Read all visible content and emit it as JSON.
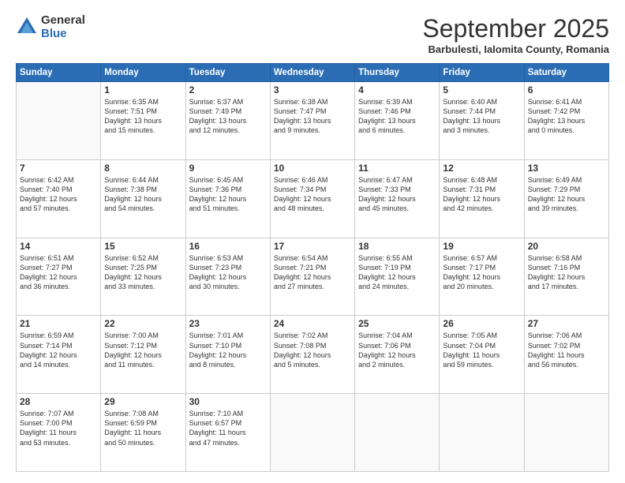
{
  "logo": {
    "general": "General",
    "blue": "Blue"
  },
  "title": "September 2025",
  "subtitle": "Barbulesti, Ialomita County, Romania",
  "header_days": [
    "Sunday",
    "Monday",
    "Tuesday",
    "Wednesday",
    "Thursday",
    "Friday",
    "Saturday"
  ],
  "weeks": [
    [
      {
        "day": "",
        "info": ""
      },
      {
        "day": "1",
        "info": "Sunrise: 6:35 AM\nSunset: 7:51 PM\nDaylight: 13 hours\nand 15 minutes."
      },
      {
        "day": "2",
        "info": "Sunrise: 6:37 AM\nSunset: 7:49 PM\nDaylight: 13 hours\nand 12 minutes."
      },
      {
        "day": "3",
        "info": "Sunrise: 6:38 AM\nSunset: 7:47 PM\nDaylight: 13 hours\nand 9 minutes."
      },
      {
        "day": "4",
        "info": "Sunrise: 6:39 AM\nSunset: 7:46 PM\nDaylight: 13 hours\nand 6 minutes."
      },
      {
        "day": "5",
        "info": "Sunrise: 6:40 AM\nSunset: 7:44 PM\nDaylight: 13 hours\nand 3 minutes."
      },
      {
        "day": "6",
        "info": "Sunrise: 6:41 AM\nSunset: 7:42 PM\nDaylight: 13 hours\nand 0 minutes."
      }
    ],
    [
      {
        "day": "7",
        "info": "Sunrise: 6:42 AM\nSunset: 7:40 PM\nDaylight: 12 hours\nand 57 minutes."
      },
      {
        "day": "8",
        "info": "Sunrise: 6:44 AM\nSunset: 7:38 PM\nDaylight: 12 hours\nand 54 minutes."
      },
      {
        "day": "9",
        "info": "Sunrise: 6:45 AM\nSunset: 7:36 PM\nDaylight: 12 hours\nand 51 minutes."
      },
      {
        "day": "10",
        "info": "Sunrise: 6:46 AM\nSunset: 7:34 PM\nDaylight: 12 hours\nand 48 minutes."
      },
      {
        "day": "11",
        "info": "Sunrise: 6:47 AM\nSunset: 7:33 PM\nDaylight: 12 hours\nand 45 minutes."
      },
      {
        "day": "12",
        "info": "Sunrise: 6:48 AM\nSunset: 7:31 PM\nDaylight: 12 hours\nand 42 minutes."
      },
      {
        "day": "13",
        "info": "Sunrise: 6:49 AM\nSunset: 7:29 PM\nDaylight: 12 hours\nand 39 minutes."
      }
    ],
    [
      {
        "day": "14",
        "info": "Sunrise: 6:51 AM\nSunset: 7:27 PM\nDaylight: 12 hours\nand 36 minutes."
      },
      {
        "day": "15",
        "info": "Sunrise: 6:52 AM\nSunset: 7:25 PM\nDaylight: 12 hours\nand 33 minutes."
      },
      {
        "day": "16",
        "info": "Sunrise: 6:53 AM\nSunset: 7:23 PM\nDaylight: 12 hours\nand 30 minutes."
      },
      {
        "day": "17",
        "info": "Sunrise: 6:54 AM\nSunset: 7:21 PM\nDaylight: 12 hours\nand 27 minutes."
      },
      {
        "day": "18",
        "info": "Sunrise: 6:55 AM\nSunset: 7:19 PM\nDaylight: 12 hours\nand 24 minutes."
      },
      {
        "day": "19",
        "info": "Sunrise: 6:57 AM\nSunset: 7:17 PM\nDaylight: 12 hours\nand 20 minutes."
      },
      {
        "day": "20",
        "info": "Sunrise: 6:58 AM\nSunset: 7:16 PM\nDaylight: 12 hours\nand 17 minutes."
      }
    ],
    [
      {
        "day": "21",
        "info": "Sunrise: 6:59 AM\nSunset: 7:14 PM\nDaylight: 12 hours\nand 14 minutes."
      },
      {
        "day": "22",
        "info": "Sunrise: 7:00 AM\nSunset: 7:12 PM\nDaylight: 12 hours\nand 11 minutes."
      },
      {
        "day": "23",
        "info": "Sunrise: 7:01 AM\nSunset: 7:10 PM\nDaylight: 12 hours\nand 8 minutes."
      },
      {
        "day": "24",
        "info": "Sunrise: 7:02 AM\nSunset: 7:08 PM\nDaylight: 12 hours\nand 5 minutes."
      },
      {
        "day": "25",
        "info": "Sunrise: 7:04 AM\nSunset: 7:06 PM\nDaylight: 12 hours\nand 2 minutes."
      },
      {
        "day": "26",
        "info": "Sunrise: 7:05 AM\nSunset: 7:04 PM\nDaylight: 11 hours\nand 59 minutes."
      },
      {
        "day": "27",
        "info": "Sunrise: 7:06 AM\nSunset: 7:02 PM\nDaylight: 11 hours\nand 56 minutes."
      }
    ],
    [
      {
        "day": "28",
        "info": "Sunrise: 7:07 AM\nSunset: 7:00 PM\nDaylight: 11 hours\nand 53 minutes."
      },
      {
        "day": "29",
        "info": "Sunrise: 7:08 AM\nSunset: 6:59 PM\nDaylight: 11 hours\nand 50 minutes."
      },
      {
        "day": "30",
        "info": "Sunrise: 7:10 AM\nSunset: 6:57 PM\nDaylight: 11 hours\nand 47 minutes."
      },
      {
        "day": "",
        "info": ""
      },
      {
        "day": "",
        "info": ""
      },
      {
        "day": "",
        "info": ""
      },
      {
        "day": "",
        "info": ""
      }
    ]
  ]
}
